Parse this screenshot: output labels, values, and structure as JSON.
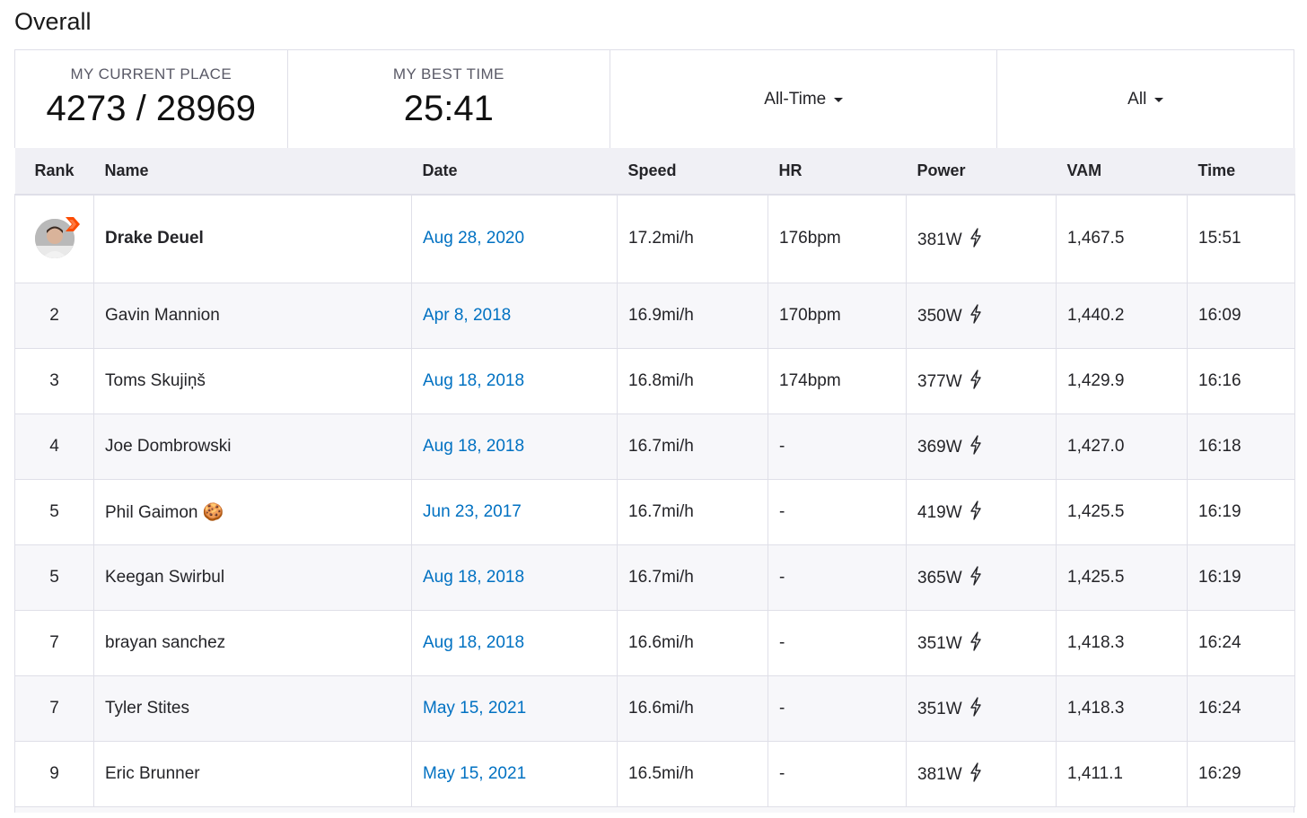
{
  "page": {
    "title": "Overall"
  },
  "summary": {
    "current_place_label": "MY CURRENT PLACE",
    "current_place_value": "4273 / 28969",
    "best_time_label": "MY BEST TIME",
    "best_time_value": "25:41",
    "time_filter": "All-Time",
    "group_filter": "All"
  },
  "table": {
    "headers": {
      "rank": "Rank",
      "name": "Name",
      "date": "Date",
      "speed": "Speed",
      "hr": "HR",
      "power": "Power",
      "vam": "VAM",
      "time": "Time"
    },
    "rows": [
      {
        "rank": "",
        "name": "Drake Deuel",
        "date": "Aug 28, 2020",
        "speed": "17.2mi/h",
        "hr": "176bpm",
        "power": "381W",
        "vam": "1,467.5",
        "time": "15:51"
      },
      {
        "rank": "2",
        "name": "Gavin Mannion",
        "date": "Apr 8, 2018",
        "speed": "16.9mi/h",
        "hr": "170bpm",
        "power": "350W",
        "vam": "1,440.2",
        "time": "16:09"
      },
      {
        "rank": "3",
        "name": "Toms Skujiņš",
        "date": "Aug 18, 2018",
        "speed": "16.8mi/h",
        "hr": "174bpm",
        "power": "377W",
        "vam": "1,429.9",
        "time": "16:16"
      },
      {
        "rank": "4",
        "name": "Joe Dombrowski",
        "date": "Aug 18, 2018",
        "speed": "16.7mi/h",
        "hr": "-",
        "power": "369W",
        "vam": "1,427.0",
        "time": "16:18"
      },
      {
        "rank": "5",
        "name": "Phil Gaimon 🍪",
        "date": "Jun 23, 2017",
        "speed": "16.7mi/h",
        "hr": "-",
        "power": "419W",
        "vam": "1,425.5",
        "time": "16:19"
      },
      {
        "rank": "5",
        "name": "Keegan Swirbul",
        "date": "Aug 18, 2018",
        "speed": "16.7mi/h",
        "hr": "-",
        "power": "365W",
        "vam": "1,425.5",
        "time": "16:19"
      },
      {
        "rank": "7",
        "name": "brayan sanchez",
        "date": "Aug 18, 2018",
        "speed": "16.6mi/h",
        "hr": "-",
        "power": "351W",
        "vam": "1,418.3",
        "time": "16:24"
      },
      {
        "rank": "7",
        "name": "Tyler Stites",
        "date": "May 15, 2021",
        "speed": "16.6mi/h",
        "hr": "-",
        "power": "351W",
        "vam": "1,418.3",
        "time": "16:24"
      },
      {
        "rank": "9",
        "name": "Eric Brunner",
        "date": "May 15, 2021",
        "speed": "16.5mi/h",
        "hr": "-",
        "power": "381W",
        "vam": "1,411.1",
        "time": "16:29"
      }
    ]
  },
  "colors": {
    "link": "#0071c2",
    "header_bg": "#f0f0f5",
    "alt_row_bg": "#f7f7fa",
    "border": "#dfdfe8",
    "badge": "#fc4c02"
  },
  "icons": {
    "power": "lightning-bolt-icon",
    "filter": "caret-down-icon",
    "badge": "chevron-badge-icon"
  }
}
